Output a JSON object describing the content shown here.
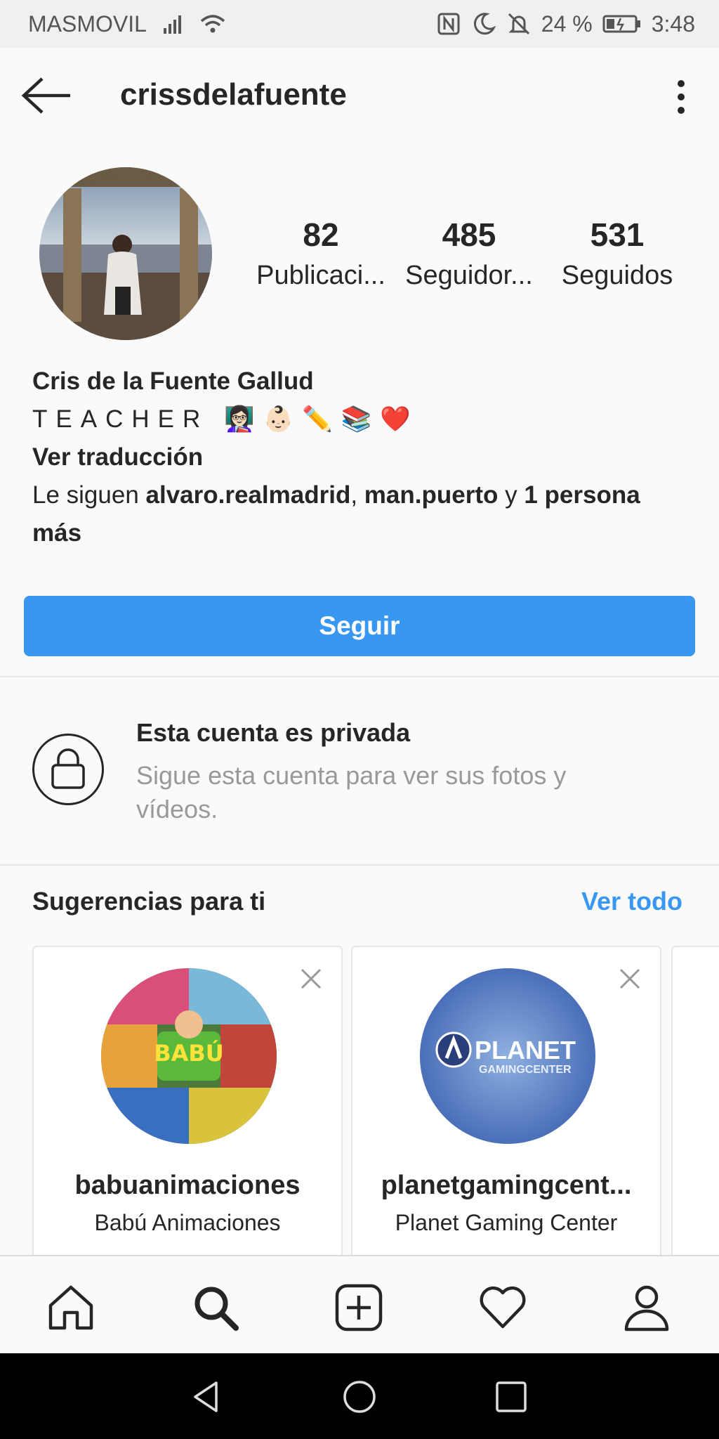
{
  "status_bar": {
    "carrier": "MASMOVIL",
    "battery": "24 %",
    "time": "3:48",
    "icons": [
      "signal-icon",
      "wifi-icon",
      "nfc-icon",
      "moon-icon",
      "mute-icon",
      "battery-icon"
    ]
  },
  "header": {
    "username": "crissdelafuente"
  },
  "profile": {
    "stats": [
      {
        "value": "82",
        "label": "Publicaci..."
      },
      {
        "value": "485",
        "label": "Seguidor..."
      },
      {
        "value": "531",
        "label": "Seguidos"
      }
    ],
    "full_name": "Cris de la Fuente Gallud",
    "bio": "TEACHER 👩🏻‍🏫👶🏻✏️📚❤️",
    "translate": "Ver traducción",
    "followed_prefix": "Le siguen ",
    "followed_user1": "alvaro.realmadrid",
    "followed_sep": ", ",
    "followed_user2": "man.puerto",
    "followed_and": " y ",
    "followed_more": "1 persona",
    "followed_more2": "más",
    "follow_button": "Seguir"
  },
  "private": {
    "title": "Esta cuenta es privada",
    "subtitle": "Sigue esta cuenta para ver sus fotos y vídeos."
  },
  "suggestions": {
    "title": "Sugerencias para ti",
    "see_all": "Ver todo",
    "cards": [
      {
        "username": "babuanimaciones",
        "full_name": "Babú Animaciones",
        "logo_text": "BABÚ"
      },
      {
        "username": "planetgamingcent...",
        "full_name": "Planet Gaming Center",
        "logo_text": "PLANET",
        "logo_sub": "GAMINGCENTER"
      }
    ]
  },
  "bottom_nav": [
    "home-icon",
    "search-icon",
    "add-icon",
    "heart-icon",
    "profile-icon"
  ],
  "colors": {
    "accent": "#3897f0",
    "text": "#262626",
    "muted": "#999999"
  }
}
